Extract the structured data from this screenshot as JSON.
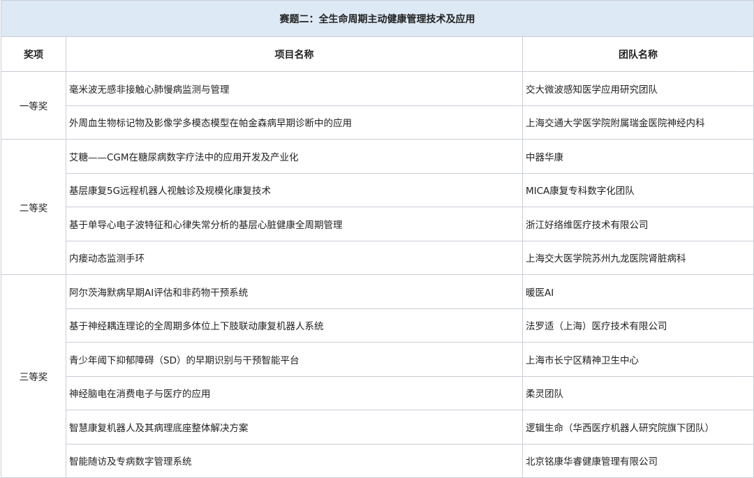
{
  "title": "赛题二：全生命周期主动健康管理技术及应用",
  "headers": {
    "prize": "奖项",
    "project": "项目名称",
    "team": "团队名称"
  },
  "groups": [
    {
      "prize": "一等奖",
      "rows": [
        {
          "project": "毫米波无感非接触心肺慢病监测与管理",
          "team": "交大微波感知医学应用研究团队"
        },
        {
          "project": "外周血生物标记物及影像学多模态模型在帕金森病早期诊断中的应用",
          "team": "上海交通大学医学院附属瑞金医院神经内科"
        }
      ]
    },
    {
      "prize": "二等奖",
      "rows": [
        {
          "project": "艾糖——CGM在糖尿病数字疗法中的应用开发及产业化",
          "team": "中器华康"
        },
        {
          "project": "基层康复5G远程机器人视触诊及规模化康复技术",
          "team": "MICA康复专科数字化团队"
        },
        {
          "project": "基于单导心电子波特征和心律失常分析的基层心脏健康全周期管理",
          "team": "浙江好络维医疗技术有限公司"
        },
        {
          "project": "内瘘动态监测手环",
          "team": "上海交大医学院苏州九龙医院肾脏病科"
        }
      ]
    },
    {
      "prize": "三等奖",
      "rows": [
        {
          "project": "阿尔茨海默病早期AI评估和非药物干预系统",
          "team": "暖医AI"
        },
        {
          "project": "基于神经耦连理论的全周期多体位上下肢联动康复机器人系统",
          "team": "法罗适（上海）医疗技术有限公司"
        },
        {
          "project": "青少年阈下抑郁障碍（SD）的早期识别与干预智能平台",
          "team": "上海市长宁区精神卫生中心"
        },
        {
          "project": "神经脑电在消费电子与医疗的应用",
          "team": "柔灵团队"
        },
        {
          "project": "智慧康复机器人及其病理底座整体解决方案",
          "team": "逻辑生命（华西医疗机器人研究院旗下团队）"
        },
        {
          "project": "智能随访及专病数字管理系统",
          "team": "北京铭康华睿健康管理有限公司"
        }
      ]
    }
  ]
}
